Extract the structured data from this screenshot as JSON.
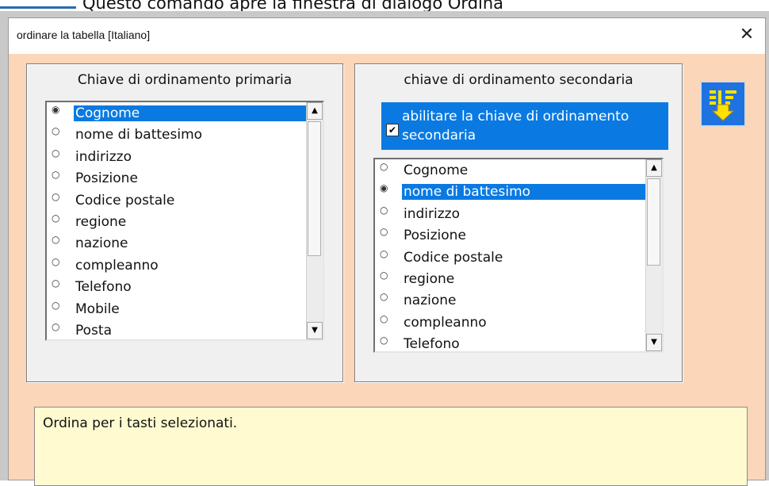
{
  "background": {
    "caption": "Questo comando apre la finestra di dialogo Ordina"
  },
  "dialog": {
    "title": "ordinare la tabella   [Italiano]",
    "close_glyph": "✕"
  },
  "primary": {
    "title": "Chiave di ordinamento primaria",
    "items": [
      "Cognome",
      "nome di battesimo",
      "indirizzo",
      "Posizione",
      "Codice postale",
      "regione",
      "nazione",
      "compleanno",
      "Telefono",
      "Mobile",
      "Posta"
    ],
    "selected": "Cognome"
  },
  "secondary": {
    "title": "chiave di ordinamento secondaria",
    "enable_label": "abilitare la chiave di ordinamento secondaria",
    "enable_checked": true,
    "items": [
      "Cognome",
      "nome di battesimo",
      "indirizzo",
      "Posizione",
      "Codice postale",
      "regione",
      "nazione",
      "compleanno",
      "Telefono"
    ],
    "selected": "nome di battesimo"
  },
  "sort_button": {
    "icon": "sort-descending-icon"
  },
  "status": {
    "text": "Ordina per i tasti selezionati."
  },
  "colors": {
    "dialog_bg": "#fcd6b8",
    "selection": "#0a7ae2",
    "status_bg": "#fffad0",
    "sort_button_bg": "#1f73e0",
    "arrow_yellow": "#ffe200"
  }
}
